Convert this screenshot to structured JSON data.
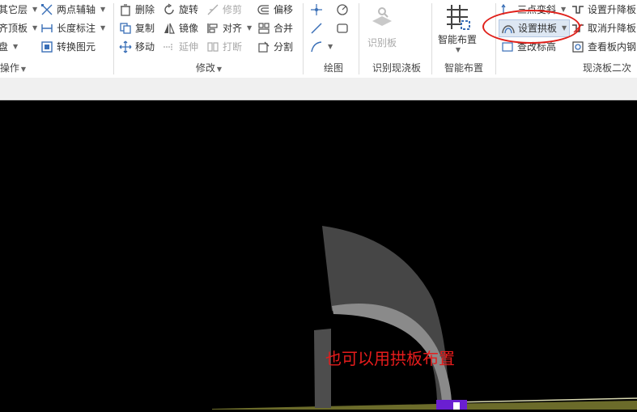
{
  "ribbon": {
    "col1": {
      "items": [
        "其它层",
        "齐顶板",
        "盘"
      ],
      "group_label": "操作"
    },
    "col2": {
      "items": [
        "两点辅轴",
        "长度标注",
        "转换图元"
      ]
    },
    "modify": {
      "row1": [
        "删除",
        "旋转",
        "修剪",
        "偏移"
      ],
      "row2": [
        "复制",
        "镜像",
        "对齐",
        "合并"
      ],
      "row3": [
        "移动",
        "延伸",
        "打断",
        "分割"
      ],
      "group_label": "修改"
    },
    "draw": {
      "group_label": "绘图"
    },
    "recognize": {
      "button": "识别板",
      "group_label": "识别现浇板"
    },
    "smart": {
      "button": "智能布置",
      "group_label": "智能布置"
    },
    "cast_slab": {
      "items_left": [
        "三点变斜",
        "设置拱板",
        "查改标高"
      ],
      "items_right": [
        "设置升降板",
        "取消升降板",
        "查看板内钢"
      ],
      "group_label": "现浇板二次"
    }
  },
  "canvas": {
    "annotation": "也可以用拱板布置"
  },
  "colors": {
    "annotation": "#e51c1c",
    "highlight_ring": "#e0201a",
    "slab": "#4a4a4a",
    "slab_edge": "#8a8a8a",
    "ground": "#6b6b2a",
    "marker": "#6a1fd1"
  }
}
